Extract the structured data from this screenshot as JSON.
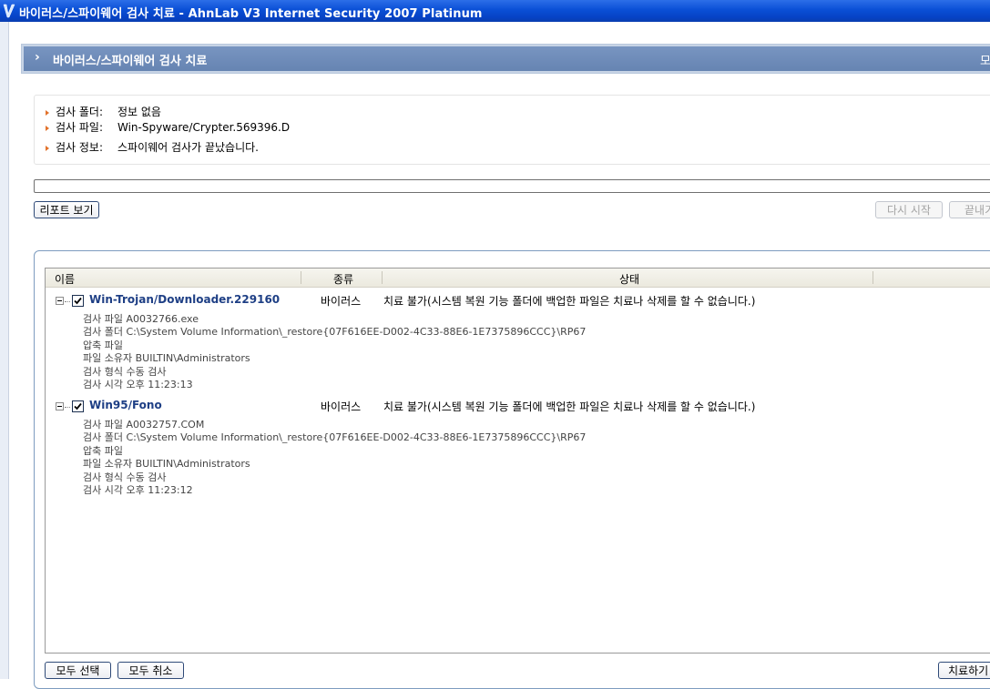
{
  "window": {
    "title": "바이러스/스파이웨어 검사 치료 - AhnLab V3 Internet Security 2007 Platinum",
    "icon": "ahnlab-v3-icon"
  },
  "section": {
    "title": "바이러스/스파이웨어 검사 치료",
    "right_text": "모"
  },
  "info": {
    "rows": [
      {
        "label": "검사 폴더:",
        "value": "정보 없음"
      },
      {
        "label": "검사 파일:",
        "value": "Win-Spyware/Crypter.569396.D"
      },
      {
        "label": "검사 정보:",
        "value": "스파이웨어 검사가 끝났습니다."
      }
    ]
  },
  "progress": {
    "value": 0
  },
  "buttons": {
    "report": "리포트 보기",
    "restart": "다시 시작",
    "finish": "끝내기",
    "select_all": "모두 선택",
    "deselect_all": "모두 취소",
    "cure": "치료하기"
  },
  "list": {
    "columns": [
      "이름",
      "종류",
      "상태"
    ],
    "items": [
      {
        "name": "Win-Trojan/Downloader.229160",
        "type": "바이러스",
        "status": "치료 불가(시스템 복원 기능 폴더에 백업한 파일은 치료나 삭제를 할 수 없습니다.)",
        "checked": true,
        "details": [
          "검사 파일 A0032766.exe",
          "검사 폴더 C:\\System Volume Information\\_restore{07F616EE-D002-4C33-88E6-1E7375896CCC}\\RP67",
          "압축 파일",
          "파일 소유자 BUILTIN\\Administrators",
          "검사 형식 수동 검사",
          "검사 시각 오후 11:23:13"
        ]
      },
      {
        "name": "Win95/Fono",
        "type": "바이러스",
        "status": "치료 불가(시스템 복원 기능 폴더에 백업한 파일은 치료나 삭제를 할 수 없습니다.)",
        "checked": true,
        "details": [
          "검사 파일 A0032757.COM",
          "검사 폴더 C:\\System Volume Information\\_restore{07F616EE-D002-4C33-88E6-1E7375896CCC}\\RP67",
          "압축 파일",
          "파일 소유자 BUILTIN\\Administrators",
          "검사 형식 수동 검사",
          "검사 시각 오후 11:23:12"
        ]
      }
    ]
  },
  "colors": {
    "titlebar": "#0a4fd6",
    "section_header": "#6f8cba",
    "item_name": "#1e3f85",
    "bullet": "#e2722b"
  }
}
